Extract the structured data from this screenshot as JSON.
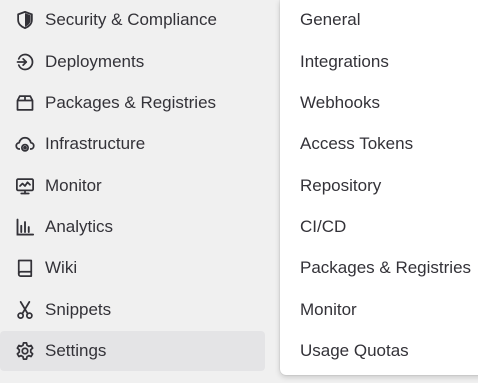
{
  "sidebar": {
    "items": [
      {
        "label": "Security & Compliance",
        "icon": "shield-icon"
      },
      {
        "label": "Deployments",
        "icon": "deployments-icon"
      },
      {
        "label": "Packages & Registries",
        "icon": "package-icon"
      },
      {
        "label": "Infrastructure",
        "icon": "cloud-gear-icon"
      },
      {
        "label": "Monitor",
        "icon": "monitor-icon"
      },
      {
        "label": "Analytics",
        "icon": "chart-icon"
      },
      {
        "label": "Wiki",
        "icon": "book-icon"
      },
      {
        "label": "Snippets",
        "icon": "scissors-icon"
      },
      {
        "label": "Settings",
        "icon": "gear-icon",
        "active": true
      }
    ]
  },
  "flyout": {
    "items": [
      {
        "label": "General"
      },
      {
        "label": "Integrations"
      },
      {
        "label": "Webhooks"
      },
      {
        "label": "Access Tokens"
      },
      {
        "label": "Repository"
      },
      {
        "label": "CI/CD"
      },
      {
        "label": "Packages & Registries"
      },
      {
        "label": "Monitor"
      },
      {
        "label": "Usage Quotas"
      }
    ]
  },
  "colors": {
    "sidebar_bg": "#f0f0f0",
    "active_bg": "#e4e4e6",
    "text": "#333238",
    "flyout_bg": "#ffffff"
  }
}
